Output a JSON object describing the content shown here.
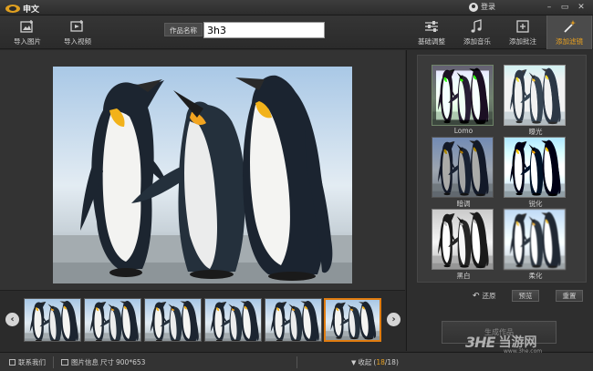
{
  "titlebar": {
    "app_name": "申文",
    "login_label": "登录",
    "buttons": [
      "–",
      "▭",
      "✕"
    ]
  },
  "toolbar": {
    "left_buttons": [
      {
        "label": "导入图片",
        "icon": "import-image-icon"
      },
      {
        "label": "导入视频",
        "icon": "import-video-icon"
      }
    ],
    "work_name_label": "作品名称",
    "work_name_value": "3h3",
    "right_tabs": [
      {
        "label": "基础调整",
        "icon": "sliders-icon",
        "active": false
      },
      {
        "label": "添加音乐",
        "icon": "music-icon",
        "active": false
      },
      {
        "label": "添加批注",
        "icon": "annotation-icon",
        "active": false
      },
      {
        "label": "添加滤镜",
        "icon": "magic-wand-icon",
        "active": true
      }
    ]
  },
  "filters": {
    "items": [
      {
        "label": "Lomo",
        "tint": "lomo"
      },
      {
        "label": "曝光",
        "tint": "exposure"
      },
      {
        "label": "暗调",
        "tint": "dark"
      },
      {
        "label": "锐化",
        "tint": "sharpen"
      },
      {
        "label": "黑白",
        "tint": "bw"
      },
      {
        "label": "柔化",
        "tint": "soft"
      }
    ],
    "restore_label": "还原",
    "preview_label": "预览",
    "reset_label": "重置",
    "generate_label": "生成作品"
  },
  "filmstrip": {
    "count": 6,
    "selected_index": 5
  },
  "statusbar": {
    "contact_label": "联系我们",
    "image_info_label": "图片信息",
    "size_label": "尺寸",
    "size_value": "900*653",
    "collapse_label": "收起",
    "current": "18",
    "total": "/18"
  },
  "watermark": {
    "mark": "3HE",
    "text": "当游网",
    "url": "www.3he.com"
  },
  "colors": {
    "accent": "#e8a020",
    "selection": "#e07c10",
    "background": "#2a2a2a"
  }
}
